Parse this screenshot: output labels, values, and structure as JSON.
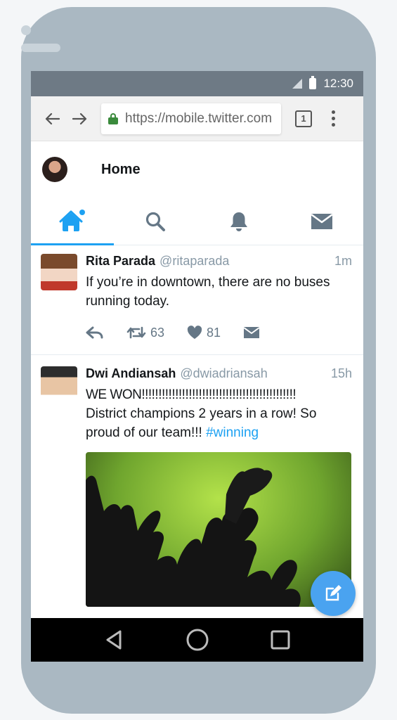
{
  "status_bar": {
    "time": "12:30"
  },
  "browser": {
    "url": "https://mobile.twitter.com",
    "tab_count": "1"
  },
  "header": {
    "title": "Home"
  },
  "tabs": [
    {
      "name": "home",
      "icon": "home-icon",
      "active": true
    },
    {
      "name": "search",
      "icon": "search-icon",
      "active": false
    },
    {
      "name": "notifications",
      "icon": "bell-icon",
      "active": false
    },
    {
      "name": "messages",
      "icon": "envelope-icon",
      "active": false
    }
  ],
  "tweets": [
    {
      "name": "Rita Parada",
      "handle": "@ritaparada",
      "time": "1m",
      "text": "If you’re in downtown, there are no buses running today.",
      "retweets": "63",
      "likes": "81"
    },
    {
      "name": "Dwi Andiansah",
      "handle": "@dwiadriansah",
      "time": "15h",
      "text_line1": "WE WON!!!!!!!!!!!!!!!!!!!!!!!!!!!!!!!!!!!!!!!!!!!!!!",
      "text_line2": "District champions 2 years in a row! So proud of our team!!! ",
      "hashtag": "#winning"
    }
  ],
  "colors": {
    "accent": "#1da1f2",
    "phone_frame": "#aab8c2",
    "status_bar": "#6e7a85"
  }
}
